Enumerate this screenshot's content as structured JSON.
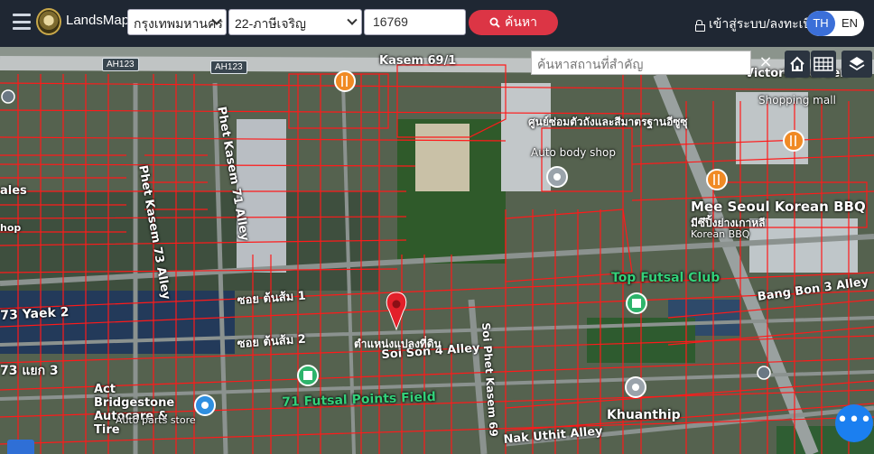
{
  "topbar": {
    "brand": "LandsMaps",
    "province": "กรุงเทพมหานคร",
    "district": "22-ภาษีเจริญ",
    "parcel_number": "16769",
    "search_label": "ค้นหา",
    "login_label": "เข้าสู่ระบบ/ลงทะเบียน",
    "lang_th": "TH",
    "lang_en": "EN"
  },
  "map": {
    "place_search_placeholder": "ค้นหาสถานที่สำคัญ",
    "clear_label": "×",
    "pin_label": "ตำแหน่งแปลงที่ดิน",
    "fab_label": "•••",
    "road_shields": [
      "AH123",
      "AH123"
    ],
    "labels": {
      "phet_kasem_73": "Phet Kasem 73 Alley",
      "phet_kasem_71": "Phet Kasem 71 Alley",
      "soi_phet_kasem_69": "Soi Phet Kasem 69",
      "kasem_69_1": "Kasem 69/1",
      "auto_body_th": "ศูนย์ซ่อมตัวถังและสีมาตรฐานอีซูซุ",
      "auto_body_en": "Auto body shop",
      "mee_seoul": "Mee Seoul Korean BBQ",
      "mee_seoul_th": "มีซึปิ้งย่างเกาหลี",
      "korean_bbq": "Korean BBQ",
      "victoria": "Victoria Garden",
      "shopping_mall": "Shopping mall",
      "top_futsal": "Top Futsal Club",
      "bang_bon_3": "Bang Bon 3 Alley",
      "soi_ton_som_1": "ซอย ต้นส้ม 1",
      "soi_ton_som_2": "ซอย ต้นส้ม 2",
      "soi_son_4": "Soi Son 4 Alley",
      "yaek_2": "73 Yaek 2",
      "yaek_3": "73 แยก 3",
      "bridgestone": "Act Bridgestone Autocare & Tire",
      "auto_parts": "Auto parts store",
      "futsal_points": "71 Futsal Points Field",
      "khuanthip": "Khuanthip",
      "nak_uthit": "Nak Uthit Alley",
      "ales": "ales",
      "shop": "hop"
    }
  },
  "colors": {
    "topbar": "#1f2733",
    "search_button": "#dc3545",
    "lang_active": "#3b6fd8",
    "parcel_lines": "#ff1a1a",
    "pin": "#e3202a"
  }
}
